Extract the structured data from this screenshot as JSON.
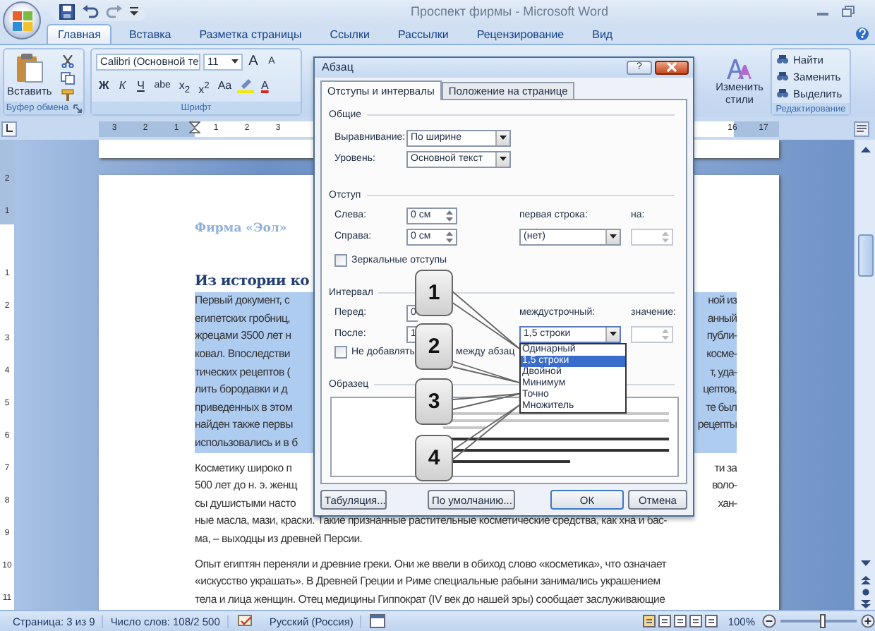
{
  "window": {
    "title": "Проспект фирмы - Microsoft Word"
  },
  "ribbon_tabs": [
    {
      "label": "Главная",
      "selected": true
    },
    {
      "label": "Вставка",
      "selected": false
    },
    {
      "label": "Разметка страницы",
      "selected": false
    },
    {
      "label": "Ссылки",
      "selected": false
    },
    {
      "label": "Рассылки",
      "selected": false
    },
    {
      "label": "Рецензирование",
      "selected": false
    },
    {
      "label": "Вид",
      "selected": false
    }
  ],
  "ribbon": {
    "clipboard": {
      "paste": "Вставить",
      "group_label": "Буфер обмена"
    },
    "font": {
      "font_name": "Calibri (Основной те",
      "font_size": "11",
      "size_buttons": [
        "A",
        "A"
      ],
      "format_buttons": [
        "Ж",
        "К",
        "Ч",
        "abe",
        "x$_{2}$",
        "x$^{2}$",
        "Aa"
      ],
      "font_color": "A",
      "group_label": "Шрифт"
    },
    "styles": {
      "change_styles": "Изменить стили"
    },
    "editing": {
      "items": [
        "Найти",
        "Заменить",
        "Выделить"
      ],
      "group_label": "Редактирование"
    }
  },
  "horizontal_ruler": {
    "left_labels": [
      "3",
      "2",
      "1"
    ],
    "page_labels": [
      "1",
      "2",
      "3"
    ],
    "right_labels": [
      "16",
      "17"
    ]
  },
  "vertical_ruler": {
    "top_labels": [
      "2",
      "1"
    ],
    "page_labels": [
      "1",
      "2",
      "3",
      "4",
      "5",
      "6",
      "7",
      "8",
      "9",
      "10",
      "11"
    ]
  },
  "document": {
    "company": "Фирма «Эол»",
    "heading": "Из истории ко",
    "lines": [
      {
        "left": "Первый документ, с",
        "right": "ной из",
        "selected": true,
        "paragraph_start": false
      },
      {
        "left": "египетских гробниц,",
        "right": "анный",
        "selected": true,
        "paragraph_start": false
      },
      {
        "left": "жрецами 3500 лет н",
        "right": "публи-",
        "selected": true,
        "paragraph_start": false
      },
      {
        "left": "ковал. Впоследстви",
        "right": "косме-",
        "selected": true,
        "paragraph_start": false
      },
      {
        "left": "тических рецептов (",
        "right": "т, уда-",
        "selected": true,
        "paragraph_start": false
      },
      {
        "left": "лить бородавки и д",
        "right": "цептов,",
        "selected": true,
        "paragraph_start": false
      },
      {
        "left": "приведенных в этом",
        "right": "те был",
        "selected": true,
        "paragraph_start": false
      },
      {
        "left": "найден также первы",
        "right": "рецепты",
        "selected": true,
        "paragraph_start": false
      },
      {
        "left": "использовались и в б",
        "selected": true,
        "paragraph_start": false
      },
      {
        "left": "Косметику широко п",
        "right": "ти за",
        "selected": false,
        "paragraph_start": true
      },
      {
        "left": "500 лет до н. э. женщ",
        "right": "воло-",
        "selected": false,
        "paragraph_start": false
      },
      {
        "left": "сы душистыми насто",
        "right": "хан-",
        "selected": false,
        "paragraph_start": false
      },
      {
        "left": "ные масла, мази, краски. Такие признанные растительные косметические средства, как хна и бас-",
        "selected": false,
        "paragraph_start": false
      },
      {
        "left": "ма, – выходцы из древней Персии.",
        "selected": false,
        "paragraph_start": false
      },
      {
        "left": "Опыт египтян переняли и древние греки. Они же ввели в обиход слово «косметика», что означает",
        "selected": false,
        "paragraph_start": true
      },
      {
        "left": "«искусство украшать». В Древней Греции и Риме специальные рабыни занимались украшением",
        "selected": false,
        "paragraph_start": false
      },
      {
        "left": "тела и лица женщин. Отец медицины Гиппократ (IV век до нашей эры) сообщает заслуживающие",
        "selected": false,
        "paragraph_start": false
      }
    ]
  },
  "dialog": {
    "title": "Абзац",
    "help_button": "?",
    "tabs": [
      {
        "label": "Отступы и интервалы",
        "selected": true
      },
      {
        "label": "Положение на странице",
        "selected": false
      }
    ],
    "general": {
      "title": "Общие",
      "alignment": {
        "label": "Выравнивание:",
        "value": "По ширине"
      },
      "level": {
        "label": "Уровень:",
        "value": "Основной текст"
      }
    },
    "indent": {
      "title": "Отступ",
      "left": {
        "label": "Слева:",
        "value": "0 см"
      },
      "right": {
        "label": "Справа:",
        "value": "0 см"
      },
      "first_line": {
        "label": "первая строка:",
        "value": "(нет)"
      },
      "by": {
        "label": "на:"
      },
      "mirror": {
        "label": "Зеркальные отступы",
        "checked": false
      }
    },
    "spacing": {
      "title": "Интервал",
      "before": {
        "label": "Перед:",
        "value": "0"
      },
      "after": {
        "label": "После:",
        "value": "1"
      },
      "line_spacing": {
        "label": "междустрочный:",
        "value": "1,5 строки",
        "options": [
          {
            "label": "Одинарный",
            "selected": false
          },
          {
            "label": "1,5 строки",
            "selected": true
          },
          {
            "label": "Двойной",
            "selected": false
          },
          {
            "label": "Минимум",
            "selected": false
          },
          {
            "label": "Точно",
            "selected": false
          },
          {
            "label": "Множитель",
            "selected": false
          }
        ]
      },
      "at": {
        "label": "значение:"
      },
      "no_space": {
        "label_parts": [
          "Не добавлять",
          "между абзац"
        ],
        "checked": false
      }
    },
    "sample": {
      "title": "Образец"
    },
    "buttons": [
      "Табуляция...",
      "По умолчанию...",
      "ОК",
      "Отмена"
    ]
  },
  "callouts": [
    "1",
    "2",
    "3",
    "4"
  ],
  "status_bar": {
    "page": "Страница: 3 из 9",
    "words": "Число слов: 108/2 500",
    "language": "Русский (Россия)",
    "zoom": "100%",
    "zoom_slider": {
      "level": 0.55
    }
  }
}
